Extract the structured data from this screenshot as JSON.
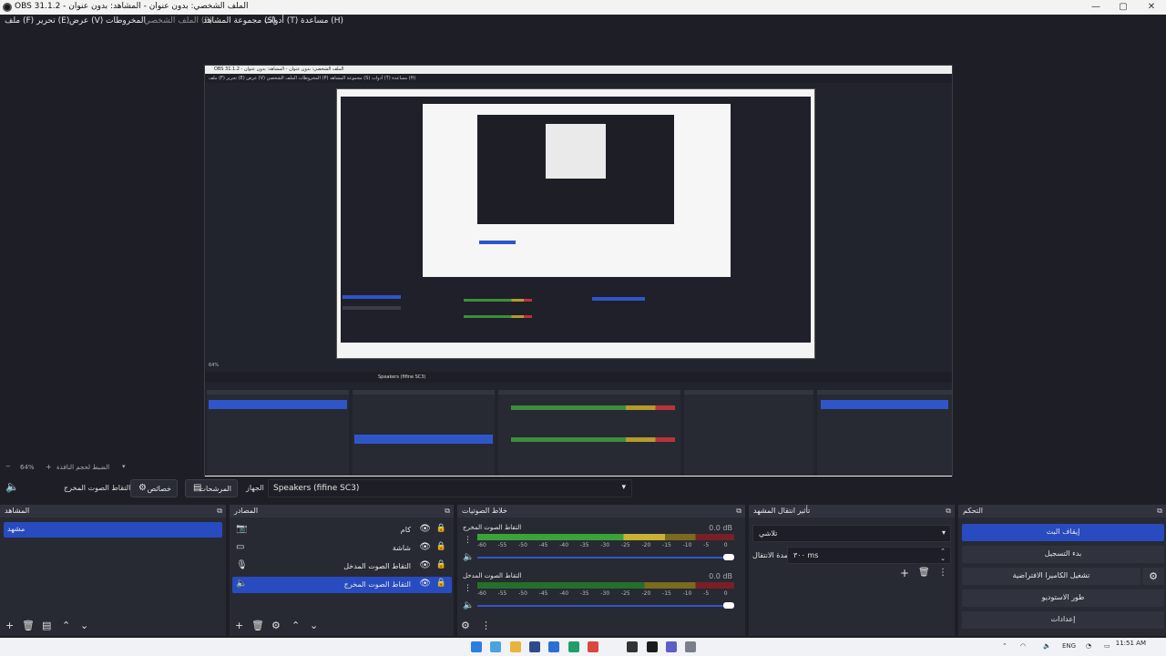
{
  "window": {
    "title": "OBS 31.1.2 - الملف الشخصي: بدون عنوان - المشاهد: بدون عنوان",
    "minimize": "—",
    "maximize": "▢",
    "close": "✕"
  },
  "menu": {
    "file": "ملف (F)",
    "edit": "تحرير (E)",
    "view": "عرض (V)",
    "docks": "المخروطات",
    "profile": "الملف الشخصي (P)",
    "scene_collection": "مجموعة المشاهد (S)",
    "tools": "أدوات (T)",
    "help": "مساعدة (H)"
  },
  "preview": {
    "nested_title": "OBS 31.1.2 - الملف الشخصي: بدون عنوان - المشاهد: بدون عنوان",
    "nested_menu": "ملف (F)   تحرير (E)   عرض (V)   المخروطات   الملف الشخصي (P)   مجموعة المشاهد (S)   أدوات (T)   مساعدة (H)",
    "nested_zoom": "64%",
    "nested_device": "Speakers (fifine SC3)"
  },
  "status": {
    "zoom": "64%",
    "fit_label": "الضبط لحجم النافذة"
  },
  "toolbar": {
    "source_label": "التقاط الصوت المخرج",
    "properties_label": "خصائص",
    "filters_label": "المرشحات",
    "device_label": "الجهاز",
    "device_value": "Speakers (fifine SC3)"
  },
  "docks": {
    "scenes": {
      "title": "المشاهد",
      "items": [
        "مشهد"
      ]
    },
    "sources": {
      "title": "المصادر",
      "items": [
        {
          "label": "كام",
          "icon": "camera"
        },
        {
          "label": "شاشة",
          "icon": "monitor"
        },
        {
          "label": "التقاط الصوت المدخل",
          "icon": "microphone"
        },
        {
          "label": "التقاط الصوت المخرج",
          "icon": "speaker"
        }
      ]
    },
    "mixer": {
      "title": "خلاط الصوتيات",
      "channels": [
        {
          "name": "التقاط الصوت المخرج",
          "db": "0.0 dB",
          "level": 0.73
        },
        {
          "name": "التقاط الصوت المدخل",
          "db": "0.0 dB",
          "level": 0.0
        }
      ],
      "ticks": [
        "-60",
        "-55",
        "-50",
        "-45",
        "-40",
        "-35",
        "-30",
        "-25",
        "-20",
        "-15",
        "-10",
        "-5",
        "0"
      ]
    },
    "transitions": {
      "title": "تأثير انتقال المشهد",
      "type": "تلاشي",
      "duration_label": "مدة الانتقال",
      "duration_value": "٣٠٠ ms"
    },
    "controls": {
      "title": "التحكم",
      "stop_stream": "إيقاف البث",
      "start_recording": "بدء التسجيل",
      "virtual_camera": "تشغيل الكاميرا الافتراضية",
      "studio_mode": "طور الاستوديو",
      "settings": "إعدادات"
    }
  },
  "taskbar": {
    "time": "11:51 AM",
    "lang": "ENG"
  },
  "colors": {
    "accent": "#284bc0",
    "background": "#1e1f26",
    "panel": "#272a33"
  }
}
